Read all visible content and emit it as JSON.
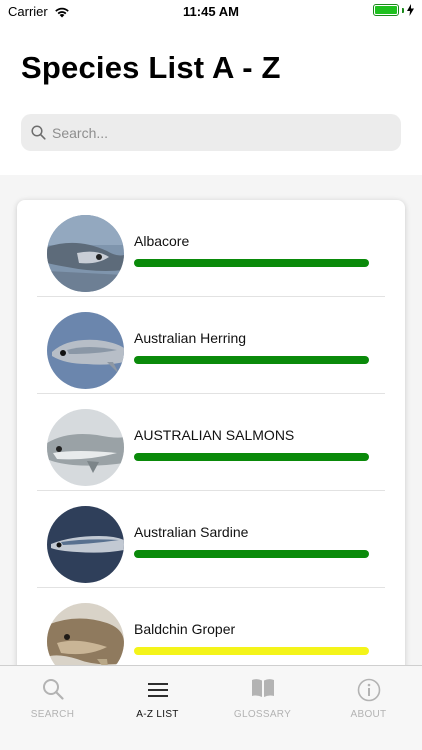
{
  "status_bar": {
    "carrier": "Carrier",
    "time": "11:45 AM"
  },
  "header": {
    "title": "Species List A - Z"
  },
  "search": {
    "placeholder": "Search..."
  },
  "species": [
    {
      "name": "Albacore",
      "status_color": "#0a8a0a",
      "image": "albacore-fish-photo"
    },
    {
      "name": "Australian Herring",
      "status_color": "#0a8a0a",
      "image": "australian-herring-fish-photo"
    },
    {
      "name": "AUSTRALIAN SALMONS",
      "status_color": "#0a8a0a",
      "image": "australian-salmon-fish-photo"
    },
    {
      "name": "Australian Sardine",
      "status_color": "#0a8a0a",
      "image": "australian-sardine-fish-photo"
    },
    {
      "name": "Baldchin Groper",
      "status_color": "#f4f41a",
      "image": "baldchin-groper-fish-photo"
    }
  ],
  "tabs": [
    {
      "label": "SEARCH",
      "icon": "search-icon",
      "active": false
    },
    {
      "label": "A-Z LIST",
      "icon": "list-icon",
      "active": true
    },
    {
      "label": "GLOSSARY",
      "icon": "book-icon",
      "active": false
    },
    {
      "label": "ABOUT",
      "icon": "info-icon",
      "active": false
    }
  ]
}
